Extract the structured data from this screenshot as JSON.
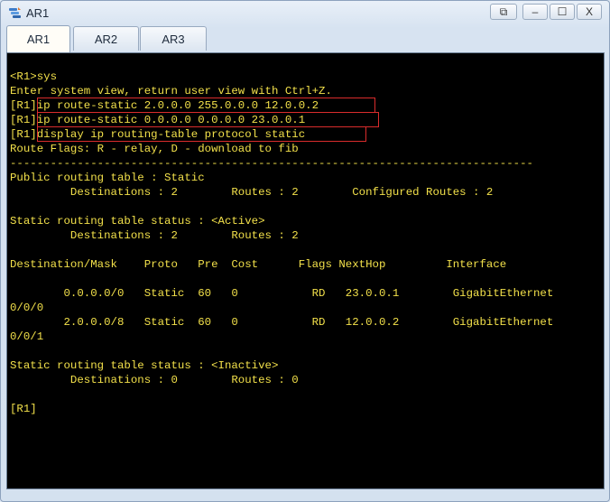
{
  "window": {
    "title": "AR1",
    "icon": "network-device-icon",
    "controls": [
      "restore-icon",
      "minimize-icon",
      "maximize-icon",
      "close-icon"
    ],
    "control_glyphs": [
      "⧉",
      "–",
      "☐",
      "X"
    ]
  },
  "tabs": [
    {
      "label": "AR1",
      "active": true
    },
    {
      "label": "AR2",
      "active": false
    },
    {
      "label": "AR3",
      "active": false
    }
  ],
  "terminal": {
    "text_color": "#f2e04a",
    "highlight_color": "#d92c2c",
    "lines": [
      "<R1>sys",
      "Enter system view, return user view with Ctrl+Z.",
      "[R1]ip route-static 2.0.0.0 255.0.0.0 12.0.0.2",
      "[R1]ip route-static 0.0.0.0 0.0.0.0 23.0.0.1",
      "[R1]display ip routing-table protocol static",
      "Route Flags: R - relay, D - download to fib",
      "------------------------------------------------------------------------------",
      "Public routing table : Static",
      "         Destinations : 2        Routes : 2        Configured Routes : 2",
      "",
      "Static routing table status : <Active>",
      "         Destinations : 2        Routes : 2",
      "",
      "Destination/Mask    Proto   Pre  Cost      Flags NextHop         Interface",
      "",
      "        0.0.0.0/0   Static  60   0           RD   23.0.0.1        GigabitEthernet",
      "0/0/0",
      "        2.0.0.0/8   Static  60   0           RD   12.0.0.2        GigabitEthernet",
      "0/0/1",
      "",
      "Static routing table status : <Inactive>",
      "         Destinations : 0        Routes : 0",
      "",
      "[R1]"
    ]
  }
}
